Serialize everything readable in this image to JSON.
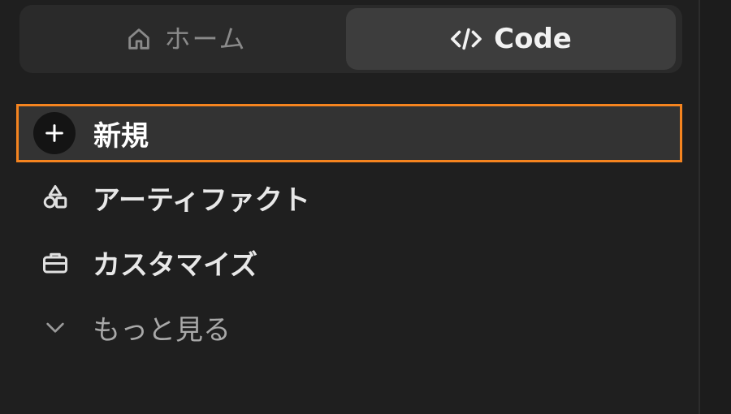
{
  "tabs": {
    "home_label": "ホーム",
    "code_label": "Code",
    "active": "Code"
  },
  "nav": {
    "new_label": "新規",
    "artifacts_label": "アーティファクト",
    "customize_label": "カスタマイズ",
    "more_label": "もっと見る"
  },
  "colors": {
    "highlight_border": "#f5841f",
    "background": "#1f1f1f"
  },
  "icons": {
    "home": "home-icon",
    "code": "code-icon",
    "new": "plus-icon",
    "artifacts": "shapes-icon",
    "customize": "briefcase-icon",
    "more": "chevron-down-icon"
  }
}
